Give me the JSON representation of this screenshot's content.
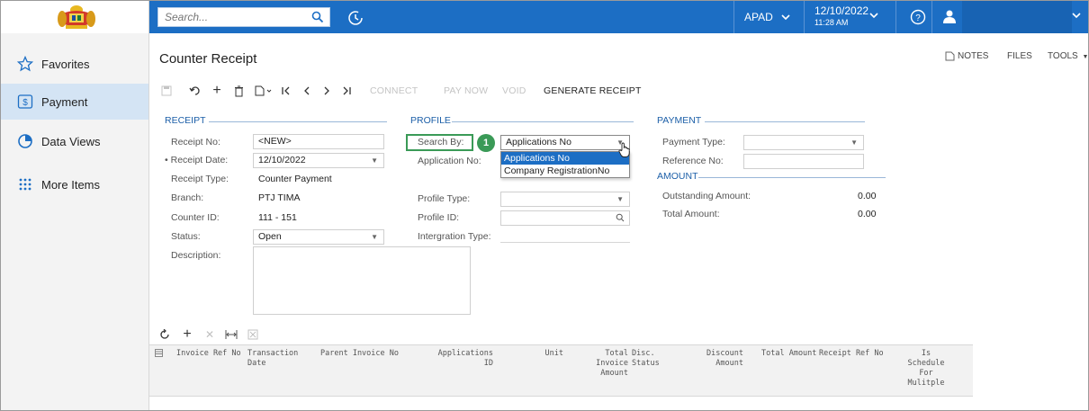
{
  "topbar": {
    "search_placeholder": "Search...",
    "company": "APAD",
    "date": "12/10/2022",
    "time": "11:28 AM",
    "accent": "#1c6ec4"
  },
  "sidebar": {
    "items": [
      {
        "label": "Favorites",
        "icon": "star-icon"
      },
      {
        "label": "Payment",
        "icon": "dollar-box-icon",
        "active": true
      },
      {
        "label": "Data Views",
        "icon": "pie-chart-icon"
      },
      {
        "label": "More Items",
        "icon": "grid-dots-icon"
      }
    ]
  },
  "page": {
    "title": "Counter Receipt",
    "notes": "NOTES",
    "files": "FILES",
    "tools": "TOOLS"
  },
  "toolbar": {
    "connect": "CONNECT",
    "pay_now": "PAY NOW",
    "void": "VOID",
    "generate_receipt": "GENERATE RECEIPT"
  },
  "receipt": {
    "header": "RECEIPT",
    "receipt_no_label": "Receipt No:",
    "receipt_no": "<NEW>",
    "receipt_date_label": "Receipt Date:",
    "receipt_date": "12/10/2022",
    "receipt_type_label": "Receipt Type:",
    "receipt_type": "Counter Payment",
    "branch_label": "Branch:",
    "branch": "PTJ TIMA",
    "counter_id_label": "Counter ID:",
    "counter_id": "111 - 151",
    "status_label": "Status:",
    "status": "Open",
    "description_label": "Description:"
  },
  "profile": {
    "header": "PROFILE",
    "search_by_label": "Search By:",
    "search_by": "Applications No",
    "application_no_label": "Application No:",
    "profile_type_label": "Profile Type:",
    "profile_id_label": "Profile ID:",
    "integration_type_label": "Intergration Type:",
    "step_badge": "1",
    "dropdown_options": [
      "Applications No",
      "Company RegistrationNo"
    ]
  },
  "payment": {
    "header": "PAYMENT",
    "payment_type_label": "Payment Type:",
    "reference_no_label": "Reference No:"
  },
  "amount": {
    "header": "AMOUNT",
    "outstanding_label": "Outstanding Amount:",
    "outstanding": "0.00",
    "total_label": "Total Amount:",
    "total": "0.00"
  },
  "grid": {
    "columns": {
      "invoice_ref_no": "Invoice Ref No",
      "transaction_date_1": "Transaction",
      "transaction_date_2": "Date",
      "parent_invoice_no": "Parent Invoice No",
      "applications_id": "Applications ID",
      "unit": "Unit",
      "total_invoice_1": "Total Invoice",
      "total_invoice_2": "Amount",
      "disc_status_1": "Disc.",
      "disc_status_2": "Status",
      "discount_amount_1": "Discount",
      "discount_amount_2": "Amount",
      "total_amount": "Total Amount",
      "receipt_ref_no": "Receipt Ref No",
      "schedule_1": "Is",
      "schedule_2": "Schedule",
      "schedule_3": "For",
      "schedule_4": "Mulitple"
    }
  }
}
